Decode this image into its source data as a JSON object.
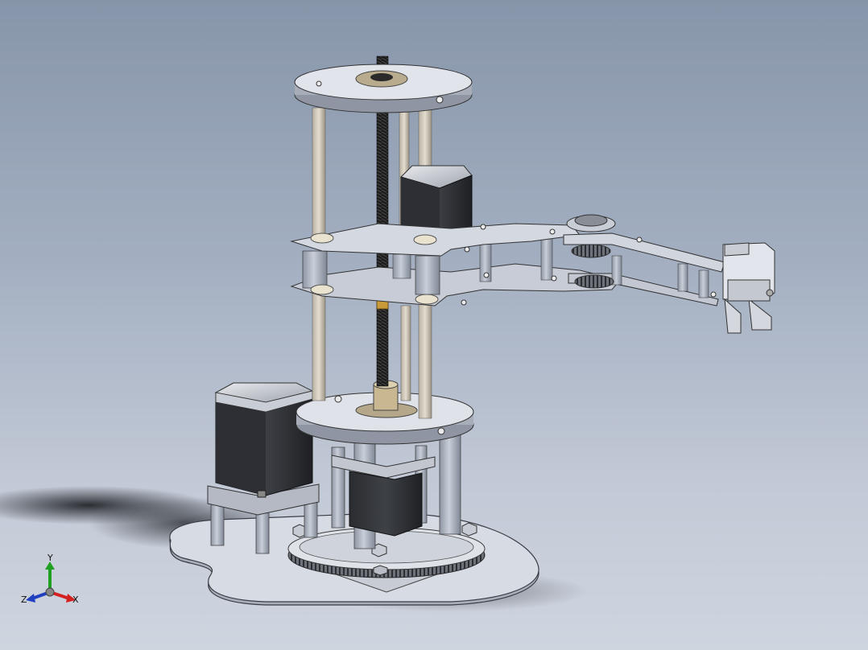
{
  "view": {
    "background_top": "#8795aa",
    "background_bottom": "#cfd5df"
  },
  "triad": {
    "y_label": "Y",
    "z_label": "Z",
    "x_label": "X",
    "x_color": "#d42020",
    "y_color": "#20a020",
    "z_color": "#2040c0"
  }
}
